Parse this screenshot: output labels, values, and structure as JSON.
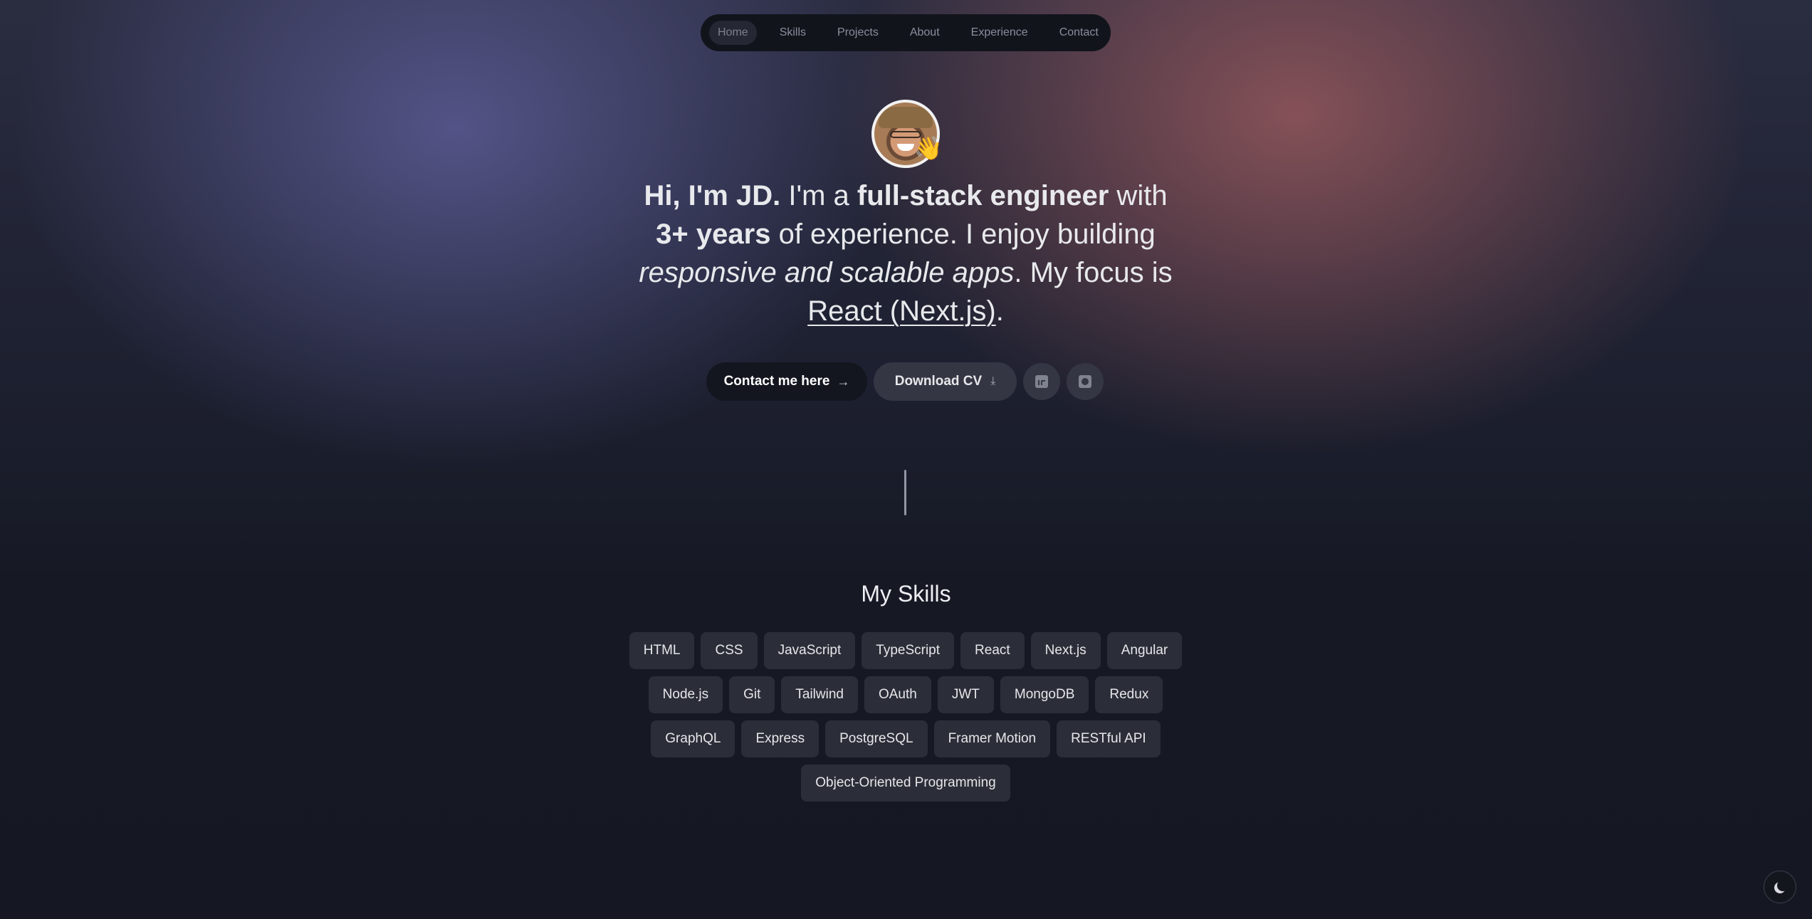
{
  "nav": {
    "items": [
      {
        "label": "Home",
        "active": true
      },
      {
        "label": "Skills"
      },
      {
        "label": "Projects"
      },
      {
        "label": "About"
      },
      {
        "label": "Experience"
      },
      {
        "label": "Contact"
      }
    ]
  },
  "hero": {
    "wave_emoji": "👋",
    "headline": {
      "p1_bold": "Hi, I'm JD.",
      "p2": " I'm a ",
      "p3_bold": "full-stack engineer",
      "p4": " with ",
      "p5_bold": "3+ years",
      "p6": " of experience. I enjoy building ",
      "p7_italic": "responsive and scalable apps",
      "p8": ". My focus is ",
      "p9_underline": "React (Next.js)",
      "p10": "."
    },
    "buttons": {
      "contact_label": "Contact me here",
      "contact_icon": "→",
      "cv_label": "Download CV",
      "cv_icon": "⤓",
      "linkedin_icon": "linkedin-icon",
      "github_icon": "github-icon"
    }
  },
  "skills": {
    "title": "My Skills",
    "items": [
      "HTML",
      "CSS",
      "JavaScript",
      "TypeScript",
      "React",
      "Next.js",
      "Angular",
      "Node.js",
      "Git",
      "Tailwind",
      "OAuth",
      "JWT",
      "MongoDB",
      "Redux",
      "GraphQL",
      "Express",
      "PostgreSQL",
      "Framer Motion",
      "RESTful API",
      "Object-Oriented Programming"
    ]
  },
  "theme_toggle": {
    "icon": "moon-icon"
  }
}
